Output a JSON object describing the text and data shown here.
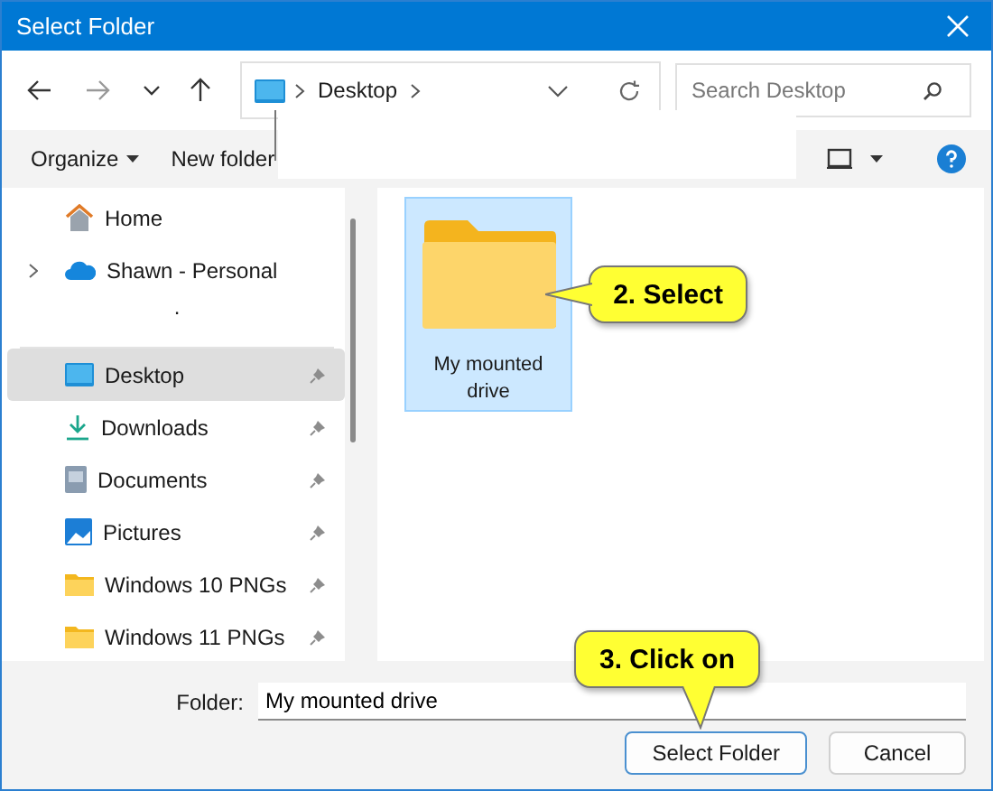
{
  "window": {
    "title": "Select Folder"
  },
  "address": {
    "segments": [
      "Desktop"
    ]
  },
  "search": {
    "placeholder": "Search Desktop"
  },
  "toolbar": {
    "organize": "Organize",
    "new_folder": "New folder"
  },
  "sidebar": {
    "separator_mark": ".",
    "items": [
      {
        "label": "Home",
        "kind": "home",
        "expandable": false,
        "pinned": false,
        "selected": false
      },
      {
        "label": "Shawn - Personal",
        "kind": "cloud",
        "expandable": true,
        "pinned": false,
        "selected": false
      },
      {
        "label": "Desktop",
        "kind": "desktop",
        "expandable": false,
        "pinned": true,
        "selected": true
      },
      {
        "label": "Downloads",
        "kind": "downloads",
        "expandable": false,
        "pinned": true,
        "selected": false
      },
      {
        "label": "Documents",
        "kind": "documents",
        "expandable": false,
        "pinned": true,
        "selected": false
      },
      {
        "label": "Pictures",
        "kind": "pictures",
        "expandable": false,
        "pinned": true,
        "selected": false
      },
      {
        "label": "Windows 10 PNGs",
        "kind": "folder",
        "expandable": false,
        "pinned": true,
        "selected": false
      },
      {
        "label": "Windows 11 PNGs",
        "kind": "folder",
        "expandable": false,
        "pinned": true,
        "selected": false
      }
    ]
  },
  "files": [
    {
      "name": "My mounted drive",
      "selected": true
    }
  ],
  "callouts": [
    {
      "text": "2. Select",
      "kind": "left"
    },
    {
      "text": "3. Click on",
      "kind": "down"
    }
  ],
  "folder_field": {
    "label": "Folder:",
    "value": "My mounted drive"
  },
  "buttons": [
    {
      "label": "Select Folder",
      "default": true
    },
    {
      "label": "Cancel",
      "default": false
    }
  ]
}
